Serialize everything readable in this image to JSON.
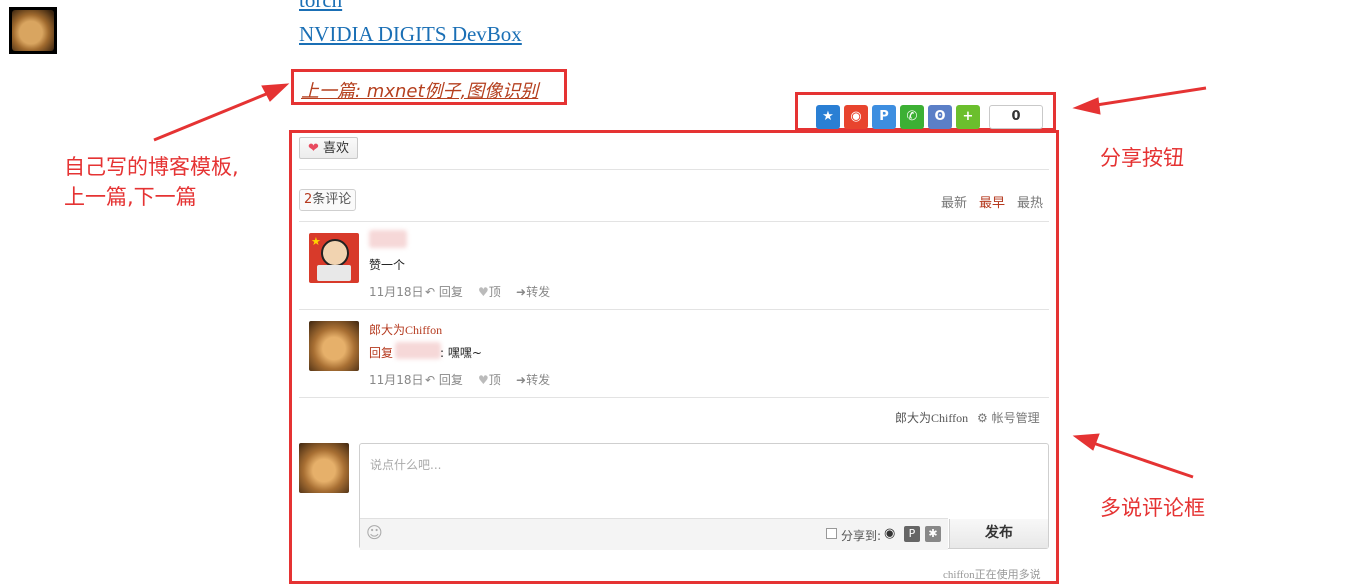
{
  "top_links": [
    "torch",
    "NVIDIA DIGITS DevBox"
  ],
  "prev_post": "上一篇: mxnet例子,图像识别",
  "annotations": {
    "blog_template": [
      "自己写的博客模板,",
      "上一篇,下一篇"
    ],
    "share_buttons": "分享按钮",
    "comment_box": "多说评论框"
  },
  "share": {
    "icons": [
      "qzone-icon",
      "weibo-icon",
      "pinterest-icon",
      "wechat-icon",
      "renren-icon",
      "more-share-icon"
    ],
    "count": "0"
  },
  "like_button": "喜欢",
  "comments_header": {
    "count_num": "2",
    "count_label": "条评论",
    "sort": [
      "最新",
      "最早",
      "最热"
    ],
    "active_sort": "最早"
  },
  "comments": [
    {
      "author": "",
      "text": "赞一个",
      "date": "11月18日",
      "actions": [
        "回复",
        "顶",
        "转发"
      ]
    },
    {
      "author": "郎大为Chiffon",
      "reply_prefix": "回复",
      "text": ": 嘿嘿~",
      "date": "11月18日",
      "actions": [
        "回复",
        "顶",
        "转发"
      ]
    }
  ],
  "account": {
    "user": "郎大为Chiffon",
    "manage": "帐号管理"
  },
  "composer": {
    "placeholder": "说点什么吧...",
    "share_to": "分享到:",
    "publish": "发布"
  },
  "footer": "chiffon正在使用多说",
  "colors": {
    "annotation_red": "#e53333",
    "link_blue": "#1a6fb5",
    "accent_red": "#b53a1f"
  }
}
